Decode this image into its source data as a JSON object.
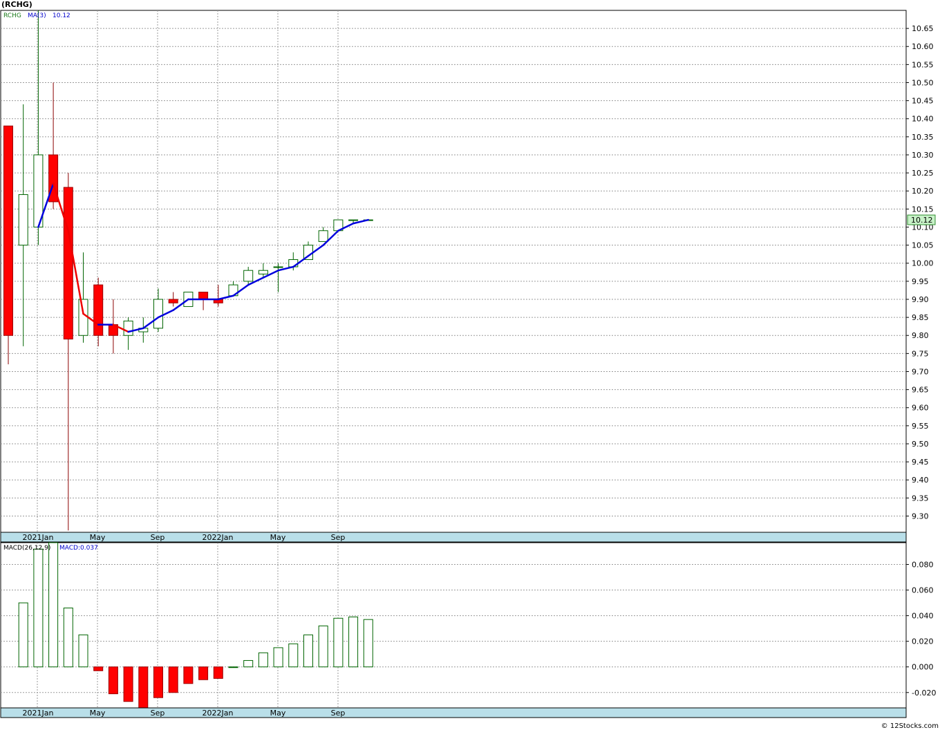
{
  "header": {
    "title": "(RCHG)"
  },
  "footer": {
    "credit": "© 12Stocks.com"
  },
  "colors": {
    "up_outline": "#006400",
    "down_fill": "#ff0000",
    "ma_line": "#0000dd",
    "ma_line_down": "#ee0000",
    "date_band": "#b9dfe9",
    "grid": "#9a9a9a",
    "last_price_tag": "#c8f2c8"
  },
  "chart_data": [
    {
      "type": "candlestick",
      "legend": {
        "symbol": "RCHG",
        "ma_label": "MA(3)",
        "ma_value": "10.12"
      },
      "ylim": [
        9.255,
        10.7
      ],
      "yticks": [
        "9.30",
        "9.35",
        "9.40",
        "9.45",
        "9.50",
        "9.55",
        "9.60",
        "9.65",
        "9.70",
        "9.75",
        "9.80",
        "9.85",
        "9.90",
        "9.95",
        "10.00",
        "10.05",
        "10.10",
        "10.15",
        "10.20",
        "10.25",
        "10.30",
        "10.35",
        "10.40",
        "10.45",
        "10.50",
        "10.55",
        "10.60",
        "10.65"
      ],
      "last_price": "10.12",
      "x_labels": [
        "2021Jan",
        "May",
        "Sep",
        "2022Jan",
        "May",
        "Sep"
      ],
      "candles": [
        {
          "o": 10.38,
          "h": 10.38,
          "l": 9.72,
          "c": 9.8
        },
        {
          "o": 10.05,
          "h": 10.44,
          "l": 9.77,
          "c": 10.19
        },
        {
          "o": 10.1,
          "h": 10.7,
          "l": 10.05,
          "c": 10.3
        },
        {
          "o": 10.3,
          "h": 10.5,
          "l": 10.15,
          "c": 10.17
        },
        {
          "o": 10.21,
          "h": 10.25,
          "l": 9.26,
          "c": 9.79
        },
        {
          "o": 9.8,
          "h": 10.03,
          "l": 9.78,
          "c": 9.9
        },
        {
          "o": 9.94,
          "h": 9.96,
          "l": 9.77,
          "c": 9.8
        },
        {
          "o": 9.83,
          "h": 9.9,
          "l": 9.75,
          "c": 9.8
        },
        {
          "o": 9.8,
          "h": 9.85,
          "l": 9.76,
          "c": 9.84
        },
        {
          "o": 9.81,
          "h": 9.85,
          "l": 9.78,
          "c": 9.82
        },
        {
          "o": 9.82,
          "h": 9.93,
          "l": 9.81,
          "c": 9.9
        },
        {
          "o": 9.9,
          "h": 9.92,
          "l": 9.88,
          "c": 9.89
        },
        {
          "o": 9.88,
          "h": 9.92,
          "l": 9.88,
          "c": 9.92
        },
        {
          "o": 9.92,
          "h": 9.92,
          "l": 9.87,
          "c": 9.9
        },
        {
          "o": 9.9,
          "h": 9.94,
          "l": 9.88,
          "c": 9.89
        },
        {
          "o": 9.91,
          "h": 9.95,
          "l": 9.91,
          "c": 9.94
        },
        {
          "o": 9.95,
          "h": 9.99,
          "l": 9.94,
          "c": 9.98
        },
        {
          "o": 9.97,
          "h": 10.0,
          "l": 9.96,
          "c": 9.98
        },
        {
          "o": 9.99,
          "h": 10.0,
          "l": 9.92,
          "c": 9.99
        },
        {
          "o": 9.99,
          "h": 10.03,
          "l": 9.98,
          "c": 10.01
        },
        {
          "o": 10.01,
          "h": 10.06,
          "l": 10.01,
          "c": 10.05
        },
        {
          "o": 10.06,
          "h": 10.1,
          "l": 10.06,
          "c": 10.09
        },
        {
          "o": 10.09,
          "h": 10.12,
          "l": 10.09,
          "c": 10.12
        },
        {
          "o": 10.12,
          "h": 10.12,
          "l": 10.11,
          "c": 10.12
        },
        {
          "o": 10.12,
          "h": 10.12,
          "l": 10.12,
          "c": 10.12
        }
      ],
      "ma3": [
        null,
        null,
        10.1,
        10.22,
        10.09,
        9.86,
        9.83,
        9.83,
        9.81,
        9.82,
        9.85,
        9.87,
        9.9,
        9.9,
        9.9,
        9.91,
        9.94,
        9.96,
        9.98,
        9.99,
        10.02,
        10.05,
        10.09,
        10.11,
        10.12
      ]
    },
    {
      "type": "bar",
      "legend": {
        "label": "MACD(26,12,9)",
        "value_label": "MACD:0.037"
      },
      "ylim": [
        -0.032,
        0.097
      ],
      "yticks": [
        "-0.020",
        "0.000",
        "0.020",
        "0.040",
        "0.060",
        "0.080"
      ],
      "x_labels": [
        "2021Jan",
        "May",
        "Sep",
        "2022Jan",
        "May",
        "Sep"
      ],
      "values": [
        0.05,
        0.092,
        0.097,
        0.046,
        0.025,
        -0.003,
        -0.021,
        -0.027,
        -0.032,
        -0.024,
        -0.02,
        -0.013,
        -0.01,
        -0.009,
        0.0,
        0.005,
        0.011,
        0.015,
        0.018,
        0.025,
        0.032,
        0.038,
        0.039,
        0.037
      ]
    }
  ]
}
